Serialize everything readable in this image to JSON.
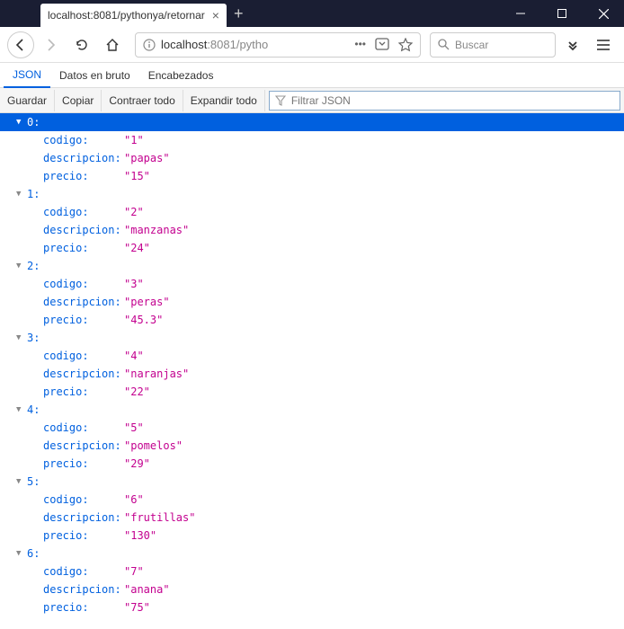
{
  "titlebar": {
    "tab_title": "localhost:8081/pythonya/retornar",
    "close": "×",
    "newtab": "+"
  },
  "nav": {
    "url_prefix": "localhost",
    "url_suffix": ":8081/pytho",
    "search_placeholder": "Buscar"
  },
  "viewtabs": {
    "json": "JSON",
    "raw": "Datos en bruto",
    "headers": "Encabezados"
  },
  "toolbar": {
    "save": "Guardar",
    "copy": "Copiar",
    "collapse": "Contraer todo",
    "expand": "Expandir todo",
    "filter_placeholder": "Filtrar JSON"
  },
  "items": [
    {
      "idx": "0",
      "codigo": "\"1\"",
      "descripcion": "\"papas\"",
      "precio": "\"15\""
    },
    {
      "idx": "1",
      "codigo": "\"2\"",
      "descripcion": "\"manzanas\"",
      "precio": "\"24\""
    },
    {
      "idx": "2",
      "codigo": "\"3\"",
      "descripcion": "\"peras\"",
      "precio": "\"45.3\""
    },
    {
      "idx": "3",
      "codigo": "\"4\"",
      "descripcion": "\"naranjas\"",
      "precio": "\"22\""
    },
    {
      "idx": "4",
      "codigo": "\"5\"",
      "descripcion": "\"pomelos\"",
      "precio": "\"29\""
    },
    {
      "idx": "5",
      "codigo": "\"6\"",
      "descripcion": "\"frutillas\"",
      "precio": "\"130\""
    },
    {
      "idx": "6",
      "codigo": "\"7\"",
      "descripcion": "\"anana\"",
      "precio": "\"75\""
    }
  ],
  "labels": {
    "codigo": "codigo:",
    "descripcion": "descripcion:",
    "precio": "precio:"
  }
}
